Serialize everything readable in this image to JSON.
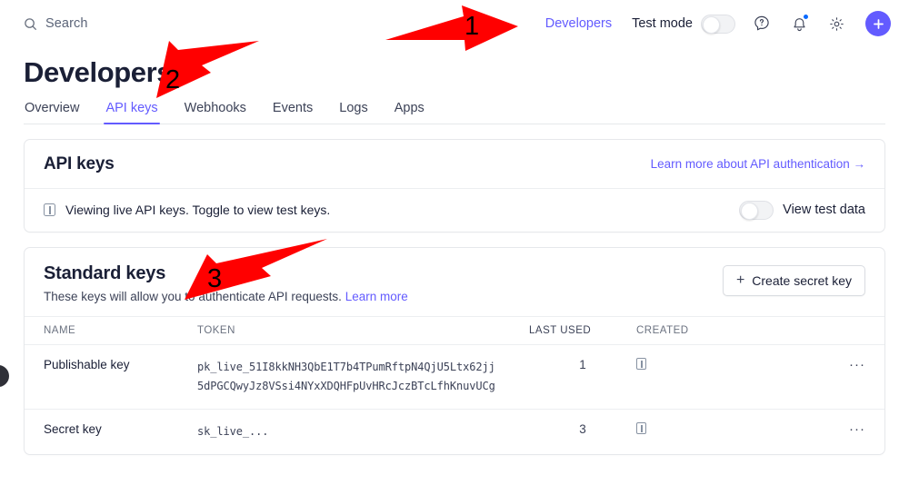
{
  "topbar": {
    "search": {
      "placeholder": "Search",
      "icon": "search-icon"
    },
    "developers_link": "Developers",
    "test_mode_label": "Test mode",
    "test_mode_on": false,
    "icons": [
      "help-icon",
      "notifications-icon",
      "settings-icon",
      "add-icon"
    ],
    "accent_color": "#635bff",
    "notification_dot_color": "#0a6aff"
  },
  "page": {
    "title": "Developers",
    "tabs": [
      {
        "label": "Overview",
        "active": false
      },
      {
        "label": "API keys",
        "active": true
      },
      {
        "label": "Webhooks",
        "active": false
      },
      {
        "label": "Events",
        "active": false
      },
      {
        "label": "Logs",
        "active": false
      },
      {
        "label": "Apps",
        "active": false
      }
    ]
  },
  "api_keys_card": {
    "title": "API keys",
    "learn_more_link": "Learn more about API authentication →",
    "notice_text": "Viewing live API keys. Toggle to view test keys.",
    "notice_icon": "info-box-icon",
    "view_test_data_label": "View test data",
    "view_test_data_on": false
  },
  "standard_keys": {
    "title": "Standard keys",
    "subtitle": "These keys will allow you to authenticate API requests.",
    "subtitle_link": "Learn more",
    "create_button": "Create secret key",
    "create_button_icon": "plus-icon",
    "columns": [
      "NAME",
      "TOKEN",
      "LAST USED",
      "CREATED",
      ""
    ],
    "rows": [
      {
        "name": "Publishable key",
        "token_line1": "pk_live_51I8kkNH3QbE1T7b4TPumRftpN4QjU5Ltx62jj",
        "token_line2": "5dPGCQwyJz8VSsi4NYxXDQHFpUvHRcJczBTcLfhKnuvUCg",
        "last_used": "1",
        "created": "",
        "created_icon": "box-glyph-icon",
        "actions": "···"
      },
      {
        "name": "Secret key",
        "token_line1": "sk_live_...",
        "token_line2": "",
        "last_used": "3",
        "created": "",
        "created_icon": "box-glyph-icon",
        "actions": "···"
      }
    ]
  },
  "annotations": {
    "color": "#ff0000",
    "markers": [
      {
        "number": "1",
        "target": "Developers link in top bar",
        "direction": "right"
      },
      {
        "number": "2",
        "target": "API keys tab",
        "direction": "down-left"
      },
      {
        "number": "3",
        "target": "Standard keys section",
        "direction": "down-left"
      }
    ]
  }
}
